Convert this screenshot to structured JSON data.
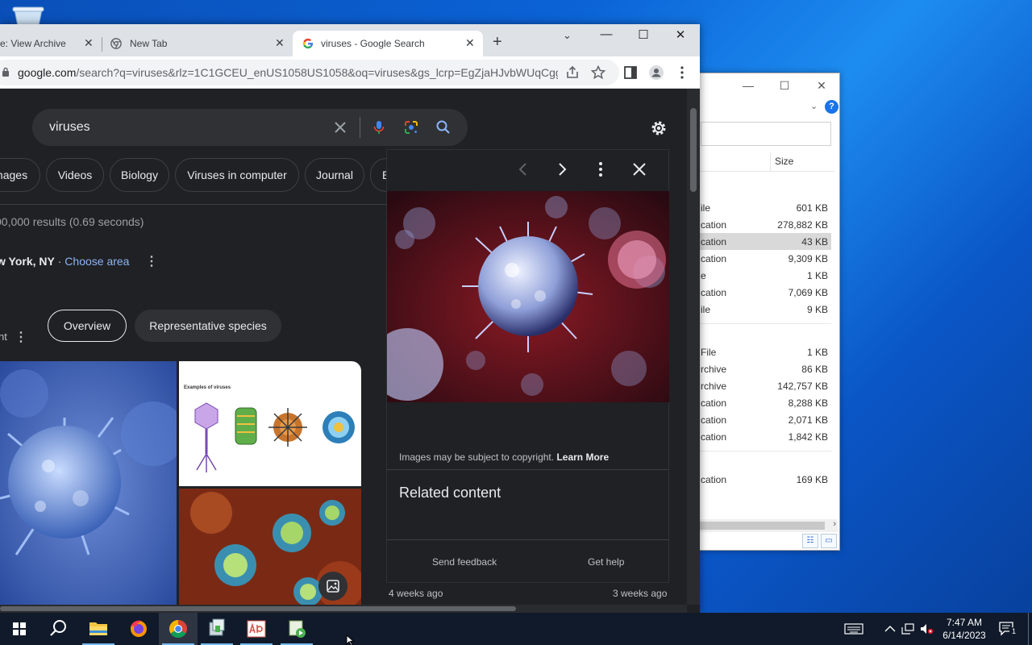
{
  "chrome": {
    "tabs": [
      {
        "label": "e: View Archive"
      },
      {
        "label": "New Tab"
      },
      {
        "label": "viruses - Google Search"
      }
    ],
    "url_domain": "google.com",
    "url_rest": "/search?q=viruses&rlz=1C1GCEU_enUS1058US1058&oq=viruses&gs_lcrp=EgZjaHJvbWUqCgg..."
  },
  "search": {
    "query": "viruses",
    "chips": [
      "nages",
      "Videos",
      "Biology",
      "Viruses in computer",
      "Journal",
      "E"
    ],
    "results_stats": "00,000 results (0.69 seconds)",
    "location_bold": "w York, NY",
    "location_sep": " · ",
    "location_link": "Choose area",
    "cut_label": "nt",
    "pills": [
      "Overview",
      "Representative species"
    ],
    "thumb_label": "Examples of viruses"
  },
  "preview": {
    "copyright": "Images may be subject to copyright.",
    "learn_more": "Learn More",
    "related_title": "Related content",
    "send_feedback": "Send feedback",
    "get_help": "Get help",
    "ago_left": "4 weeks ago",
    "ago_right": "3 weeks ago"
  },
  "explorer": {
    "size_header": "Size",
    "rows": [
      {
        "type": "ile",
        "size": "601 KB"
      },
      {
        "type": "cation",
        "size": "278,882 KB"
      },
      {
        "type": "cation",
        "size": "43 KB",
        "selected": true
      },
      {
        "type": "cation",
        "size": "9,309 KB"
      },
      {
        "type": "e",
        "size": "1 KB"
      },
      {
        "type": "cation",
        "size": "7,069 KB"
      },
      {
        "type": "ile",
        "size": "9 KB"
      },
      {
        "type": "File",
        "size": "1 KB"
      },
      {
        "type": "rchive",
        "size": "86 KB"
      },
      {
        "type": "rchive",
        "size": "142,757 KB"
      },
      {
        "type": "cation",
        "size": "8,288 KB"
      },
      {
        "type": "cation",
        "size": "2,071 KB"
      },
      {
        "type": "cation",
        "size": "1,842 KB"
      },
      {
        "type": "cation",
        "size": "169 KB"
      }
    ]
  },
  "taskbar": {
    "time": "7:47 AM",
    "date": "6/14/2023",
    "notif_count": "1"
  }
}
